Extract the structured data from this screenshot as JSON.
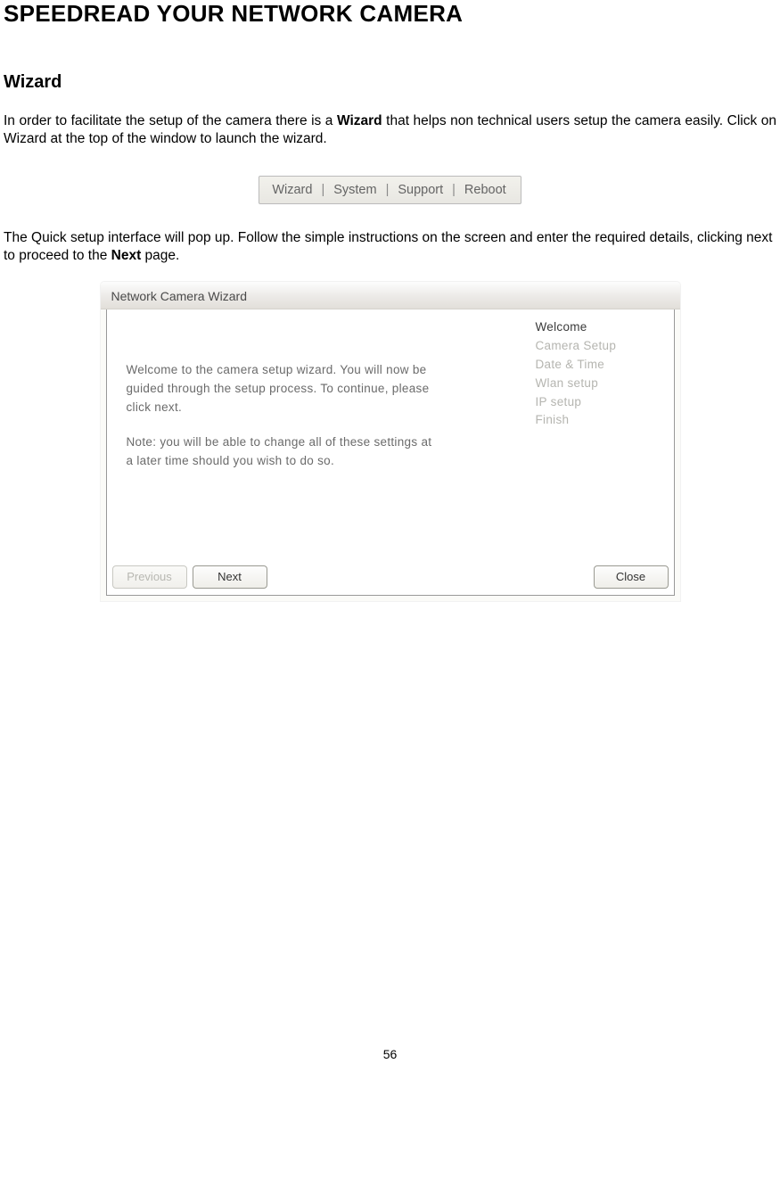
{
  "heading": "SPEEDREAD YOUR NETWORK CAMERA",
  "section": "Wizard",
  "intro_pre": "In order to facilitate the setup of the camera there is a ",
  "intro_bold": "Wizard",
  "intro_post": " that helps non technical users setup the camera easily. Click on Wizard at the top of the window to launch the wizard.",
  "menubar": {
    "items": [
      "Wizard",
      "System",
      "Support",
      "Reboot"
    ],
    "sep": "|"
  },
  "para2_pre": "The Quick setup interface will pop up. Follow the simple instructions on the screen and enter the required details, clicking next to proceed to the ",
  "para2_bold": "Next",
  "para2_post": " page.",
  "wizard": {
    "title": "Network Camera Wizard",
    "welcome_p1": "Welcome to the camera setup wizard. You will now be guided through the setup process. To continue, please click next.",
    "welcome_p2": "Note: you will be able to change all of these settings at a later time should you wish to do so.",
    "steps": [
      "Welcome",
      "Camera Setup",
      "Date & Time",
      "Wlan setup",
      "IP setup",
      "Finish"
    ],
    "active_step": 0,
    "buttons": {
      "prev": "Previous",
      "next": "Next",
      "close": "Close"
    }
  },
  "page_number": "56"
}
